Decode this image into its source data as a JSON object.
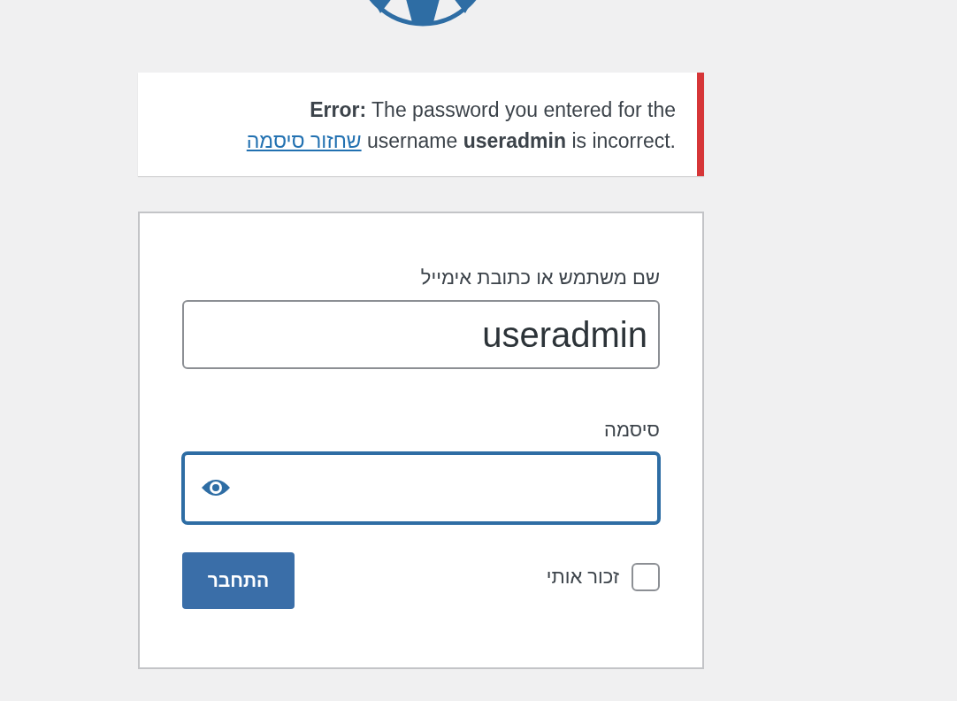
{
  "notice": {
    "message": "**Error:** The password you entered for the username **useradmin** is incorrect.",
    "link": "שחזור סיסמה"
  },
  "form": {
    "username_label": "שם משתמש או כתובת אימייל",
    "username": "useradmin",
    "password_label": "סיסמה",
    "password_focused": true,
    "remember": {
      "label": "זכור אותי",
      "checked": false
    },
    "submit": "התחבר"
  }
}
